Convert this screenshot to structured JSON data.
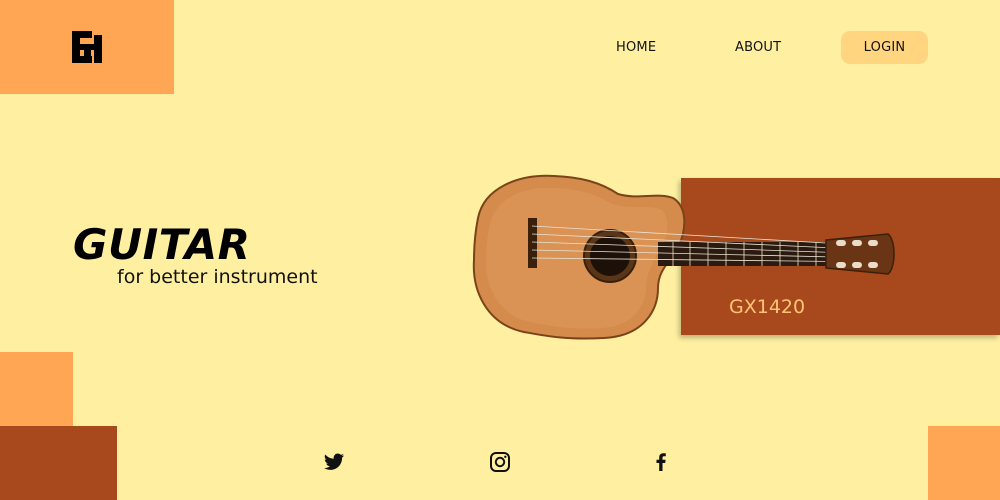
{
  "header": {
    "logo_icon": "eh-monogram-logo",
    "nav": {
      "home": "HOME",
      "about": "ABOUT",
      "login": "LOGIN"
    }
  },
  "hero": {
    "title": "GUITAR",
    "subtitle": "for better instrument"
  },
  "product": {
    "name": "GX1420",
    "image_icon": "acoustic-guitar"
  },
  "social": {
    "icons": [
      "twitter-icon",
      "instagram-icon",
      "facebook-icon"
    ]
  },
  "colors": {
    "background": "#FFF0A1",
    "accent_orange": "#FFA654",
    "accent_brown": "#A8481D",
    "login_button": "#FFD67F",
    "product_text": "#FFC474"
  }
}
